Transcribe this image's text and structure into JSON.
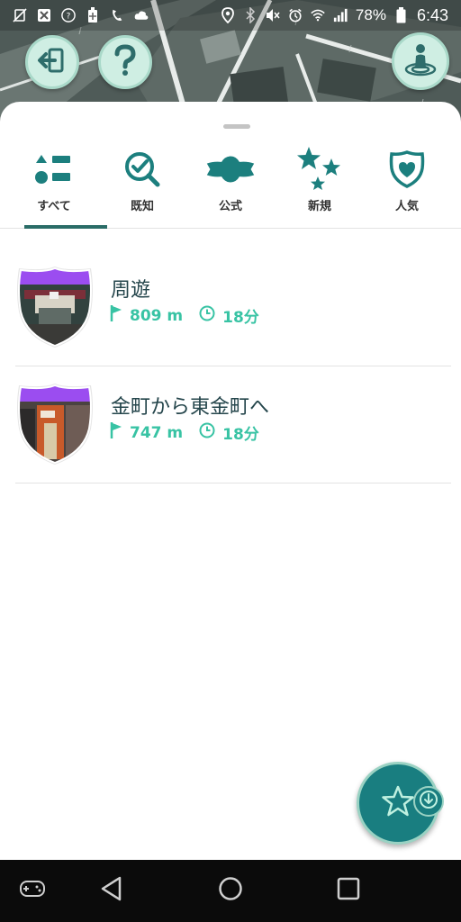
{
  "status_bar": {
    "battery_percent": "78%",
    "time": "6:43"
  },
  "tabs": [
    {
      "label": "すべて",
      "icon": "list-icon",
      "active": true
    },
    {
      "label": "既知",
      "icon": "search-check-icon",
      "active": false
    },
    {
      "label": "公式",
      "icon": "banner-icon",
      "active": false
    },
    {
      "label": "新規",
      "icon": "stars-icon",
      "active": false
    },
    {
      "label": "人気",
      "icon": "heart-shield-icon",
      "active": false
    }
  ],
  "routes": [
    {
      "title": "周遊",
      "distance": "809 m",
      "duration": "18分"
    },
    {
      "title": "金町から東金町へ",
      "distance": "747 m",
      "duration": "18分"
    }
  ],
  "colors": {
    "teal_dark": "#197e80",
    "teal_accent": "#38c3a4",
    "title_text": "#24454b",
    "badge_purple": "#9b4df0"
  }
}
